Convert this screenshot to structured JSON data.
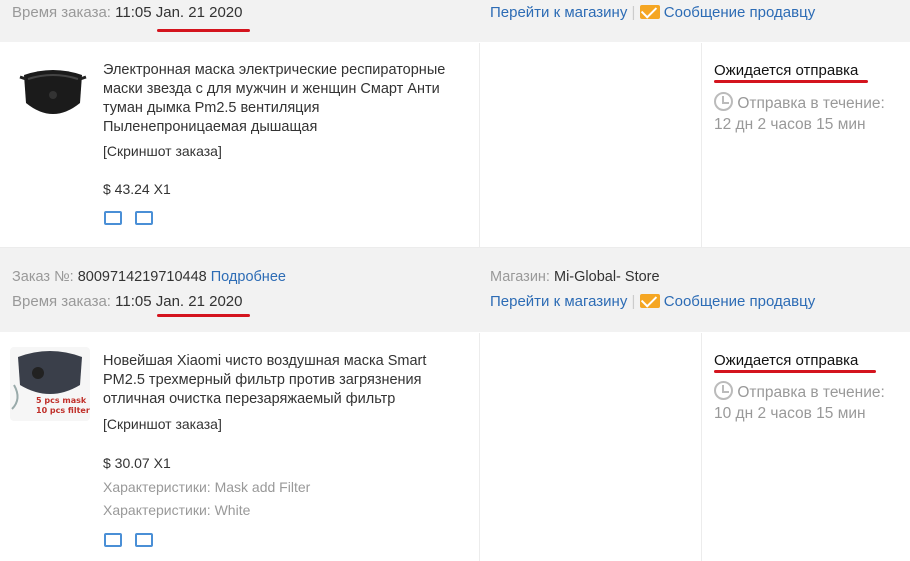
{
  "labels": {
    "order_number": "Заказ №:",
    "order_time": "Время заказа:",
    "store": "Магазин:",
    "details_link": "Подробнее",
    "go_to_store": "Перейти к магазину",
    "message_seller": "Сообщение продавцу",
    "separator": "|",
    "snapshot": "[Скриншот заказа]",
    "characteristics": "Характеристики:"
  },
  "orders": [
    {
      "time": "11:05",
      "date": "Jan. 21 2020",
      "product": {
        "title": "Электронная маска электрические респираторные маски звезда с для мужчин и женщин Смарт Анти туман дымка Pm2.5 вентиляция Пыленепроницаемая дышащая",
        "price": "$ 43.24 X1"
      },
      "status": "Ожидается отправка",
      "ship_label": "Отправка в течение:",
      "ship_time": "12 дн 2 часов 15 мин"
    },
    {
      "number": "8009714219710448",
      "time": "11:05",
      "date": "Jan. 21 2020",
      "store_name": "Mi-Global- Store",
      "product": {
        "title": "Новейшая Xiaomi чисто воздушная маска Smart PM2.5 трехмерный фильтр против загрязнения отличная очистка перезаряжаемый фильтр",
        "price": "$ 30.07 X1",
        "image_text": [
          "5 pcs mask",
          "10 pcs filter"
        ],
        "specs": [
          "Mask add Filter",
          "White"
        ]
      },
      "status": "Ожидается отправка",
      "ship_label": "Отправка в течение:",
      "ship_time": "10 дн 2 часов 15 мин"
    }
  ],
  "colors": {
    "link": "#2d6cb5",
    "underline": "#d4141e",
    "header_bg": "#f2f2f2"
  }
}
